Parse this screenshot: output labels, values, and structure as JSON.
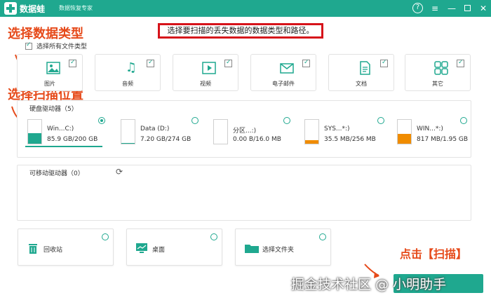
{
  "titlebar": {
    "app_name": "数据蛙",
    "subtitle": "数据恢复专家",
    "help": "?",
    "menu": "≡",
    "minimize": "—",
    "close": "✕"
  },
  "notice": "选择要扫描的丢失数据的数据类型和路径。",
  "annotations": {
    "select_type": "选择数据类型",
    "select_location": "选择扫描位置",
    "click_scan": "点击【扫描】"
  },
  "select_all_label": "选择所有文件类型",
  "file_types": [
    {
      "label": "图片",
      "icon": "image-icon"
    },
    {
      "label": "音频",
      "icon": "music-icon"
    },
    {
      "label": "视频",
      "icon": "video-icon"
    },
    {
      "label": "电子邮件",
      "icon": "email-icon"
    },
    {
      "label": "文档",
      "icon": "document-icon"
    },
    {
      "label": "其它",
      "icon": "other-icon"
    }
  ],
  "hard_drives": {
    "title": "硬盘驱动器（5）",
    "drives": [
      {
        "name": "Win...C:)",
        "size": "85.9 GB/200 GB",
        "used": 0.43,
        "color": "#1fa88f"
      },
      {
        "name": "Data (D:)",
        "size": "7.20 GB/274 GB",
        "used": 0.03,
        "color": "#1fa88f"
      },
      {
        "name": "分区...:)",
        "size": "0.00  B/16.0 MB",
        "used": 0.0,
        "color": "#f08c00"
      },
      {
        "name": "SYS...*:)",
        "size": "35.5 MB/256 MB",
        "used": 0.14,
        "color": "#f08c00"
      },
      {
        "name": "WIN...*:)",
        "size": "817 MB/1.95 GB",
        "used": 0.42,
        "color": "#f08c00"
      }
    ]
  },
  "removable": {
    "title": "可移动驱动器（0）"
  },
  "locations": [
    {
      "label": "回收站",
      "icon": "trash-icon"
    },
    {
      "label": "桌面",
      "icon": "desktop-icon"
    },
    {
      "label": "选择文件夹",
      "icon": "folder-icon"
    }
  ],
  "watermark": "掘金技术社区 @ 小明助手",
  "colors": {
    "accent": "#1fa88f",
    "annotation": "#e64a1a",
    "notice_border": "#d6131a",
    "warning": "#f08c00"
  }
}
